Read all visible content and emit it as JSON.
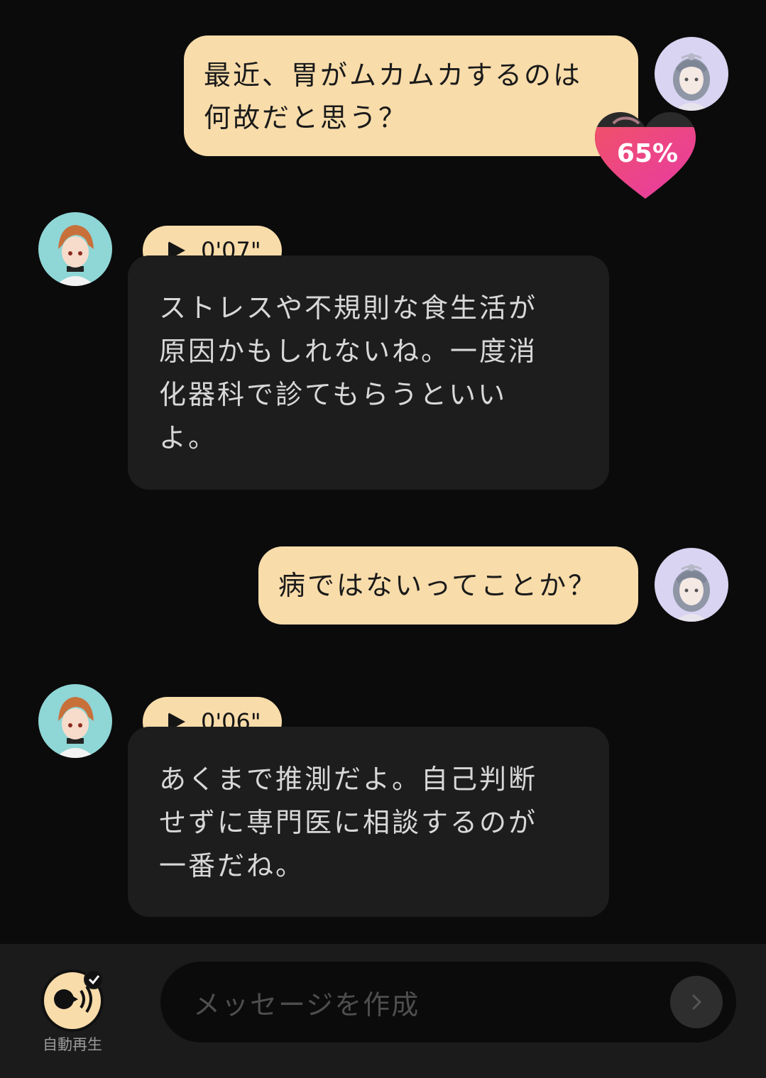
{
  "messages": [
    {
      "role": "user",
      "text_lines": [
        "最近、胃がムカムカするのは",
        "何故だと思う？"
      ],
      "affection": "65%"
    },
    {
      "role": "bot",
      "voice_duration": "0'07\"",
      "text_lines": [
        "ストレスや不規則な食生活が",
        "原因かもしれないね。一度消",
        "化器科で診てもらうといい",
        "よ。"
      ]
    },
    {
      "role": "user",
      "text_lines": [
        "病ではないってことか？"
      ]
    },
    {
      "role": "bot",
      "voice_duration": "0'06\"",
      "text_lines": [
        "あくまで推測だよ。自己判断",
        "せずに専門医に相談するのが",
        "一番だね。"
      ]
    }
  ],
  "input": {
    "placeholder": "メッセージを作成"
  },
  "autoplay": {
    "label": "自動再生",
    "icon": "autoplay-speaker-icon",
    "enabled": true
  },
  "colors": {
    "background": "#0b0b0b",
    "user_bubble": "#f8dcaa",
    "bot_bubble": "#1d1d1d",
    "heart": "#ec4f8c"
  }
}
